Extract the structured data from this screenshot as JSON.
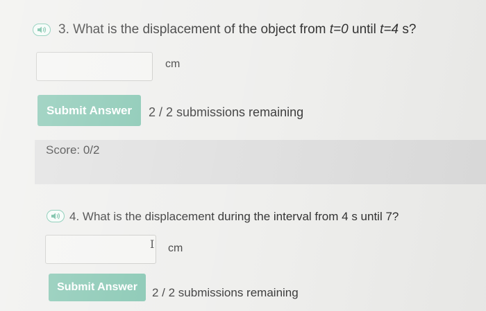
{
  "question3": {
    "number": "3.",
    "prefix": "What is the displacement of the object from ",
    "var1": "t=0",
    "middle": " until ",
    "var2": "t=4",
    "suffix": " s?",
    "answer_value": "",
    "unit": "cm",
    "submit_label": "Submit Answer",
    "remaining": "2 / 2 submissions remaining"
  },
  "score": {
    "label": "Score: 0/2"
  },
  "question4": {
    "number": "4.",
    "text": "What is the displacement during the interval from 4 s until 7?",
    "answer_value": "",
    "unit": "cm",
    "submit_label": "Submit Answer",
    "remaining": "2 / 2 submissions remaining"
  },
  "colors": {
    "accent_green": "#7ec3ad",
    "score_panel": "#dedede",
    "background": "#eeeeec"
  },
  "icons": {
    "audio": "speaker-icon",
    "text_cursor": "text-cursor-icon"
  }
}
